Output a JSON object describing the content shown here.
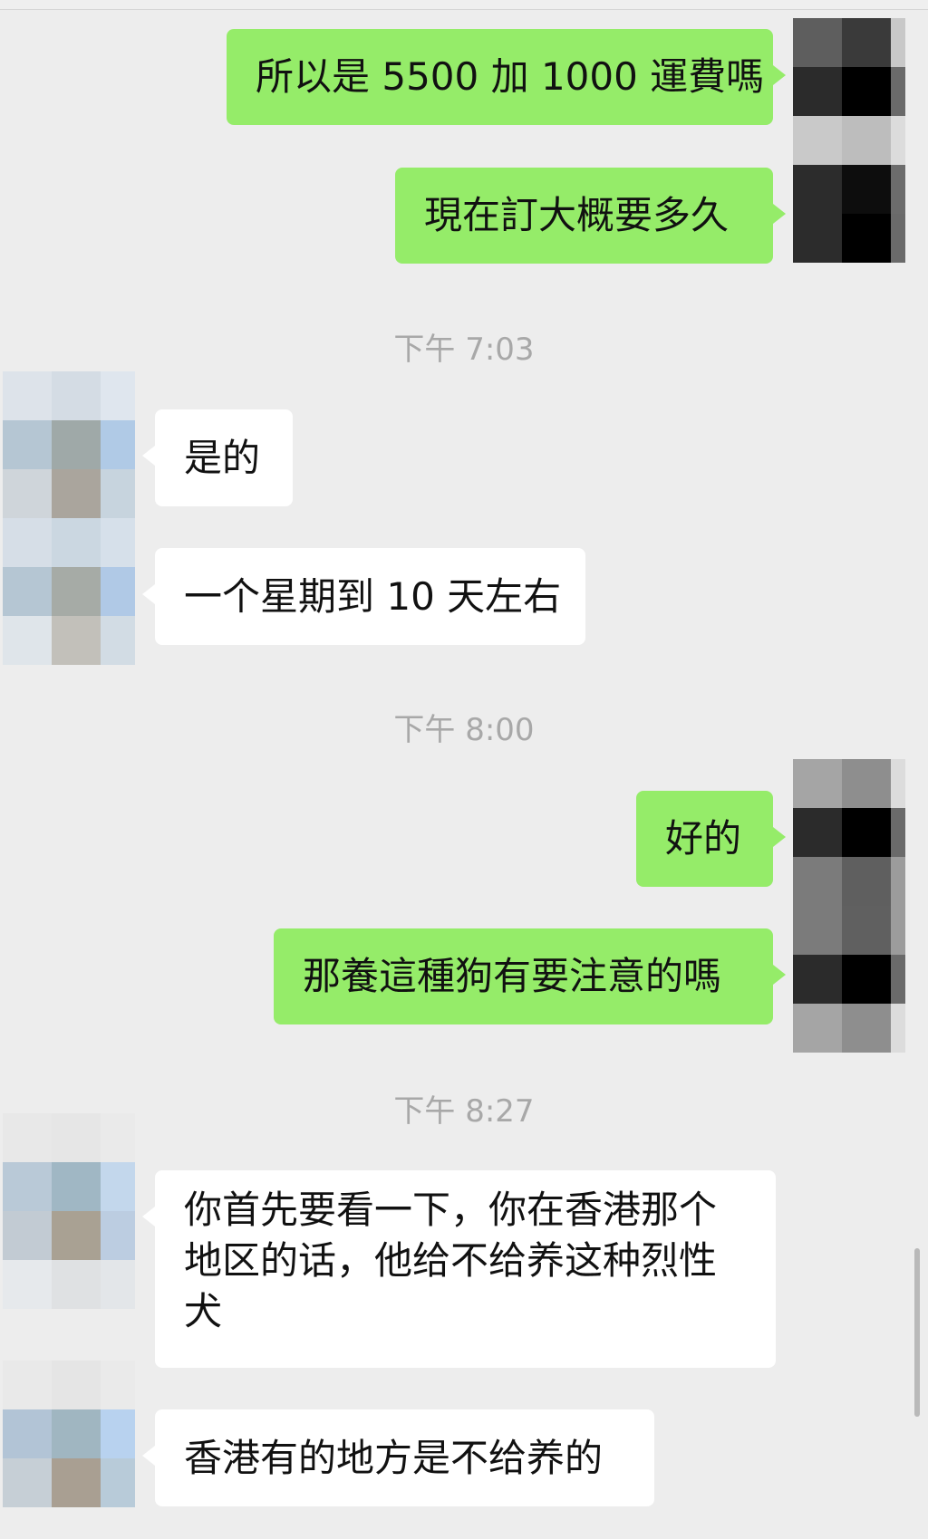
{
  "messages": [
    {
      "side": "sent",
      "text": "所以是 5500 加 1000 運費嗎"
    },
    {
      "side": "sent",
      "text": "現在訂大概要多久"
    },
    {
      "side": "recv",
      "text": "是的"
    },
    {
      "side": "recv",
      "text": "一个星期到 10 天左右"
    },
    {
      "side": "sent",
      "text": "好的"
    },
    {
      "side": "sent",
      "text": "那養這種狗有要注意的嗎"
    },
    {
      "side": "recv",
      "text": "你首先要看一下，你在香港那个地区的话，他给不给养这种烈性犬"
    },
    {
      "side": "recv",
      "text": "香港有的地方是不给养的"
    }
  ],
  "timestamps": [
    "下午 7:03",
    "下午 8:00",
    "下午 8:27"
  ],
  "avatars": {
    "sent_1": [
      "#5e5e5e",
      "#3a3a3a",
      "#c8c8c8",
      "#2b2b2b",
      "#000000",
      "#6a6a6a",
      "#c9c9c9",
      "#bdbdbd",
      "#dcdcdc",
      "#2c2c2c",
      "#0d0d0d",
      "#6c6c6c",
      "#2c2c2c",
      "#000000",
      "#6a6a6a"
    ],
    "recv_1": [
      "#dde3ea",
      "#d4dce4",
      "#dfe6ee",
      "#b5c6d3",
      "#9fa9a8",
      "#b0cae6",
      "#cfd5da",
      "#aaa59d",
      "#c7d4de",
      "#d6dee7",
      "#cbd7e1",
      "#d6e0ea",
      "#b5c6d3",
      "#a6aba6",
      "#b0c9e6",
      "#dfe5ea",
      "#c2c0ba",
      "#d2dce4"
    ],
    "sent_2": [
      "#a5a5a5",
      "#8e8e8e",
      "#dcdcdc",
      "#2b2b2b",
      "#000000",
      "#6a6a6a",
      "#7b7b7b",
      "#5f5f5f",
      "#9c9c9c",
      "#7b7b7b",
      "#606060",
      "#9c9c9c",
      "#2b2b2b",
      "#000000",
      "#6a6a6a",
      "#a5a5a5",
      "#8e8e8e",
      "#dcdcdc"
    ],
    "recv_2": [
      "#e8e8e8",
      "#e6e6e6",
      "#eaeaea",
      "#b9c9d7",
      "#a0b7c4",
      "#c3d7ec",
      "#c2cbd3",
      "#a9a193",
      "#bccde1",
      "#e6e9ec",
      "#dfe1e3",
      "#e3e6e9"
    ],
    "recv_3": [
      "#e9e9e9",
      "#e5e5e5",
      "#eaeaea",
      "#b2c4d6",
      "#a0b6c1",
      "#b8d2ef",
      "#c6cfd6",
      "#a99f92",
      "#b8cbd9"
    ]
  }
}
